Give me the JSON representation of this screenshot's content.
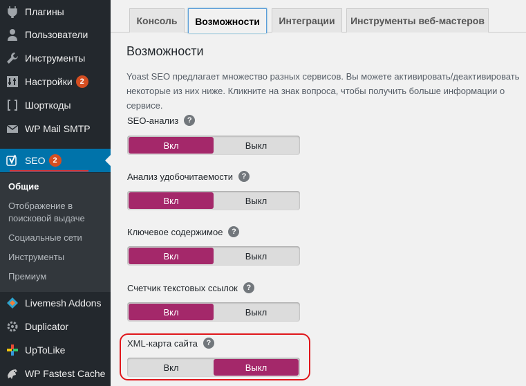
{
  "sidebar": {
    "items": [
      {
        "label": "Плагины",
        "icon": "plugin-icon"
      },
      {
        "label": "Пользователи",
        "icon": "users-icon"
      },
      {
        "label": "Инструменты",
        "icon": "wrench-icon"
      },
      {
        "label": "Настройки",
        "icon": "settings-icon",
        "badge": "2"
      },
      {
        "label": "Шорткоды",
        "icon": "brackets-icon"
      },
      {
        "label": "WP Mail SMTP",
        "icon": "envelope-icon"
      },
      {
        "label": "SEO",
        "icon": "yoast-icon",
        "badge": "2",
        "active": true
      }
    ],
    "submenu": [
      {
        "label": "Общие",
        "current": true
      },
      {
        "label": "Отображение в поисковой выдаче"
      },
      {
        "label": "Социальные сети"
      },
      {
        "label": "Инструменты"
      },
      {
        "label": "Премиум"
      }
    ],
    "lower_items": [
      {
        "label": "Livemesh Addons",
        "icon": "livemesh-icon"
      },
      {
        "label": "Duplicator",
        "icon": "duplicator-icon"
      },
      {
        "label": "UpToLike",
        "icon": "uptolike-icon"
      },
      {
        "label": "WP Fastest Cache",
        "icon": "cheetah-icon"
      }
    ]
  },
  "tabs": [
    {
      "label": "Консоль"
    },
    {
      "label": "Возможности",
      "active": true
    },
    {
      "label": "Интеграции"
    },
    {
      "label": "Инструменты веб-мастеров"
    }
  ],
  "page": {
    "title": "Возможности",
    "intro": "Yoast SEO предлагает множество разных сервисов. Вы можете активировать/деактивировать некоторые из них ниже. Кликните на знак вопроса, чтобы получить больше информации о сервисе."
  },
  "features": [
    {
      "label": "SEO-анализ",
      "on_label": "Вкл",
      "off_label": "Выкл",
      "value": "on"
    },
    {
      "label": "Анализ удобочитаемости",
      "on_label": "Вкл",
      "off_label": "Выкл",
      "value": "on"
    },
    {
      "label": "Ключевое содержимое",
      "on_label": "Вкл",
      "off_label": "Выкл",
      "value": "on"
    },
    {
      "label": "Счетчик текстовых ссылок",
      "on_label": "Вкл",
      "off_label": "Выкл",
      "value": "on"
    },
    {
      "label": "XML-карта сайта",
      "on_label": "Вкл",
      "off_label": "Выкл",
      "value": "off"
    }
  ],
  "help_glyph": "?",
  "colors": {
    "sidebar_bg": "#23282d",
    "active_menu": "#0073aa",
    "toggle_active": "#a4286a",
    "badge": "#d54e21",
    "highlight": "#e0161b"
  }
}
